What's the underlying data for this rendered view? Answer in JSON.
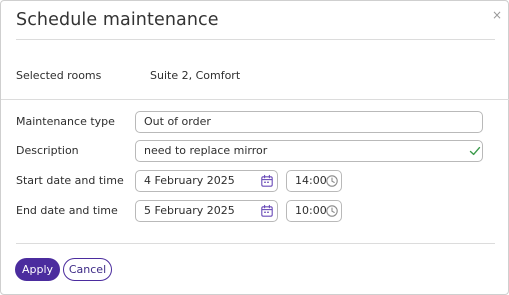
{
  "dialog": {
    "title": "Schedule maintenance",
    "close_glyph": "×"
  },
  "selected_rooms": {
    "label": "Selected rooms",
    "value": "Suite 2, Comfort"
  },
  "form": {
    "maintenance_type": {
      "label": "Maintenance type",
      "value": "Out of order"
    },
    "description": {
      "label": "Description",
      "value": "need to replace mirror",
      "status": "valid"
    },
    "start": {
      "label": "Start date and time",
      "date": "4 February 2025",
      "time": "14:00"
    },
    "end": {
      "label": "End date and time",
      "date": "5 February 2025",
      "time": "10:00"
    }
  },
  "actions": {
    "apply_label": "Apply",
    "cancel_label": "Cancel"
  },
  "icons": {
    "calendar": "calendar-icon",
    "clock": "clock-icon",
    "check": "check-icon",
    "close": "close-icon"
  },
  "colors": {
    "accent": "#4b2c9e",
    "calendar_icon": "#6a4bb8",
    "clock_icon": "#8a8a8a",
    "valid_check": "#3a9a4a"
  }
}
